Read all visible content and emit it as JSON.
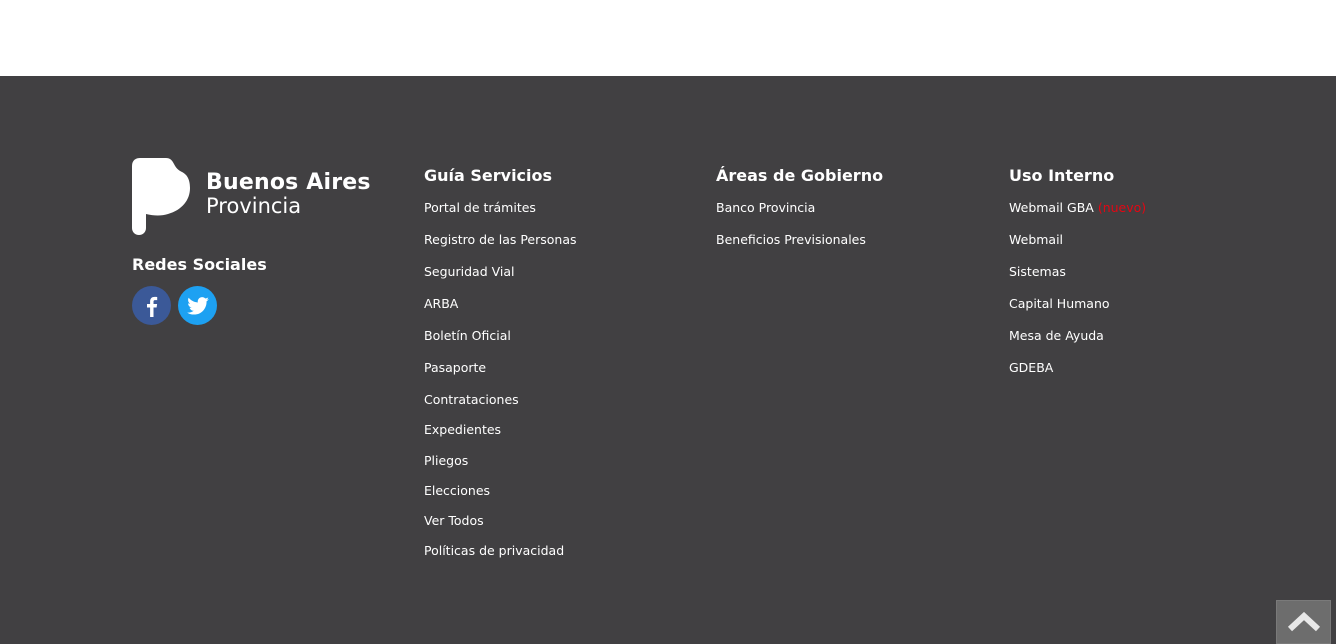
{
  "brand": {
    "line1": "Buenos Aires",
    "line2": "Provincia"
  },
  "social": {
    "title": "Redes Sociales",
    "icons": [
      "facebook-icon",
      "twitter-icon"
    ]
  },
  "guia": {
    "title": "Guía Servicios",
    "links": [
      "Portal de trámites",
      "Registro de las Personas",
      "Seguridad Vial",
      "ARBA",
      "Boletín Oficial",
      "Pasaporte",
      "Contrataciones",
      "Expedientes",
      "Pliegos",
      "Elecciones",
      "Ver Todos",
      "Políticas de privacidad"
    ]
  },
  "areas": {
    "title": "Áreas de Gobierno",
    "links": [
      "Banco Provincia",
      "Beneficios Previsionales"
    ]
  },
  "uso": {
    "title": "Uso Interno",
    "links": [
      "Webmail GBA",
      "Webmail",
      "Sistemas",
      "Capital Humano",
      "Mesa de Ayuda",
      "GDEBA"
    ],
    "new_badge": "(nuevo)"
  },
  "colors": {
    "footer_bg": "#414042",
    "facebook": "#3b5998",
    "twitter": "#1da1f2",
    "badge": "#e30613"
  },
  "scroll_top_icon": "chevron-up-icon"
}
